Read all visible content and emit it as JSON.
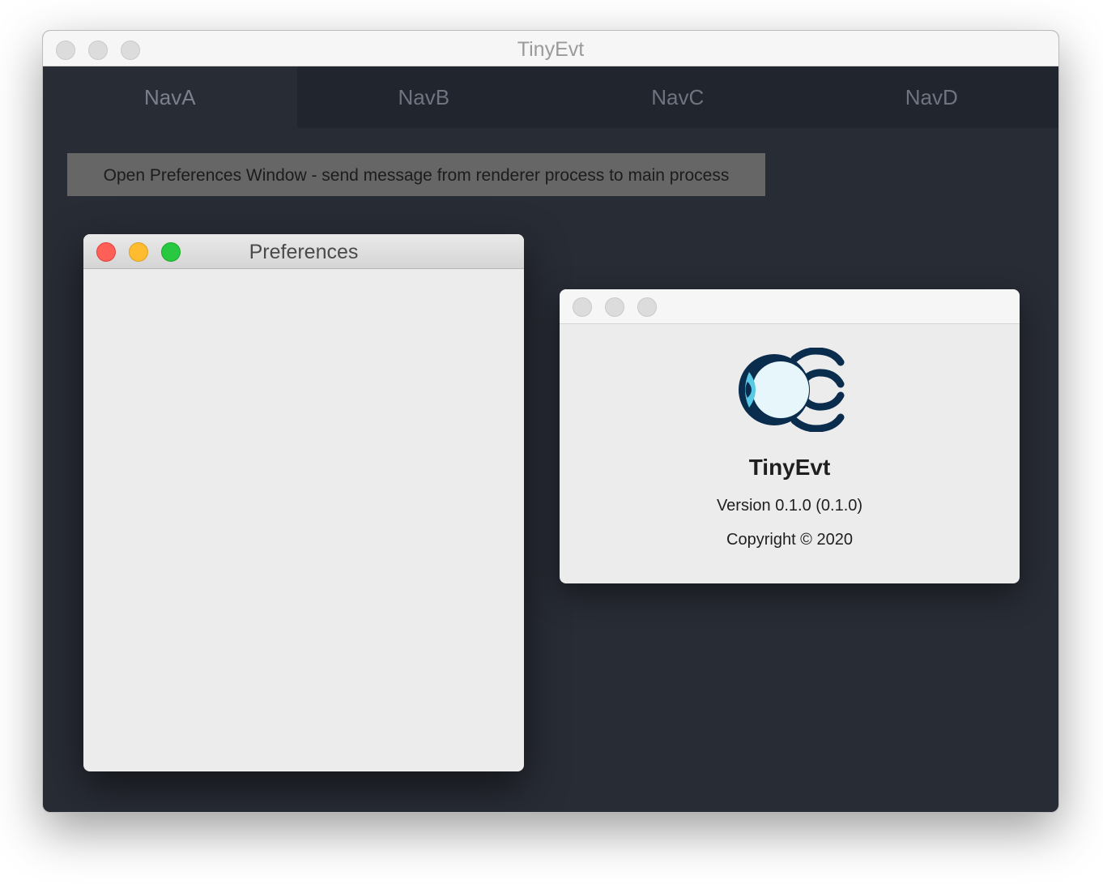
{
  "window": {
    "title": "TinyEvt"
  },
  "nav": {
    "tabs": [
      {
        "label": "NavA",
        "active": true
      },
      {
        "label": "NavB",
        "active": false
      },
      {
        "label": "NavC",
        "active": false
      },
      {
        "label": "NavD",
        "active": false
      }
    ]
  },
  "main": {
    "open_prefs_label": "Open Preferences Window - send message from renderer process to main process"
  },
  "preferences_window": {
    "title": "Preferences"
  },
  "about_window": {
    "app_name": "TinyEvt",
    "version": "Version 0.1.0 (0.1.0)",
    "copyright": "Copyright © 2020",
    "logo_icon": "eye-logo-icon"
  },
  "colors": {
    "background": "#282c35",
    "navbar": "#21252d",
    "button": "#666666",
    "logo_dark": "#0a2d4e",
    "logo_light": "#e6f6fa",
    "logo_accent": "#59c9e6"
  }
}
